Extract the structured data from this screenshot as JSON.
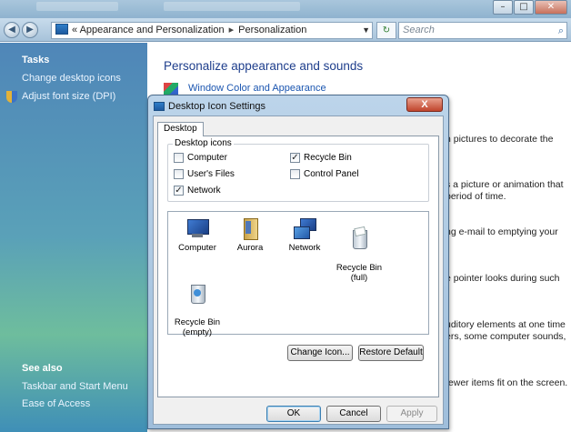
{
  "explorer": {
    "breadcrumb": [
      "Appearance and Personalization",
      "Personalization"
    ],
    "breadcrumb_prefix": "«",
    "search_placeholder": "Search"
  },
  "sidebar": {
    "tasks_heading": "Tasks",
    "tasks": [
      "Change desktop icons",
      "Adjust font size (DPI)"
    ],
    "see_also_heading": "See also",
    "see_also": [
      "Taskbar and Start Menu",
      "Ease of Access"
    ]
  },
  "main": {
    "title": "Personalize appearance and sounds",
    "first_link": "Window Color and Appearance",
    "peek_texts": [
      "n pictures to decorate the",
      "s a picture or animation that\nperiod of time.",
      "ng e-mail to emptying your",
      "e pointer looks during such",
      "uditory elements at one time\ners, some computer sounds,",
      "fewer items fit on the screen."
    ]
  },
  "dialog": {
    "title": "Desktop Icon Settings",
    "close_glyph": "X",
    "tab": "Desktop",
    "group_label": "Desktop icons",
    "checkboxes": [
      {
        "label": "Computer",
        "checked": false
      },
      {
        "label": "Recycle Bin",
        "checked": true
      },
      {
        "label": "User's Files",
        "checked": false
      },
      {
        "label": "Control Panel",
        "checked": false
      },
      {
        "label": "Network",
        "checked": true
      }
    ],
    "icons": [
      {
        "name": "Computer",
        "icon": "computer-icon"
      },
      {
        "name": "Aurora",
        "icon": "user-folder-icon"
      },
      {
        "name": "Network",
        "icon": "network-icon"
      },
      {
        "name": "Recycle Bin\n(full)",
        "icon": "recycle-bin-full-icon"
      },
      {
        "name": "Recycle Bin\n(empty)",
        "icon": "recycle-bin-empty-icon"
      }
    ],
    "change_icon": "Change Icon...",
    "restore_default": "Restore Default",
    "ok": "OK",
    "cancel": "Cancel",
    "apply": "Apply"
  }
}
